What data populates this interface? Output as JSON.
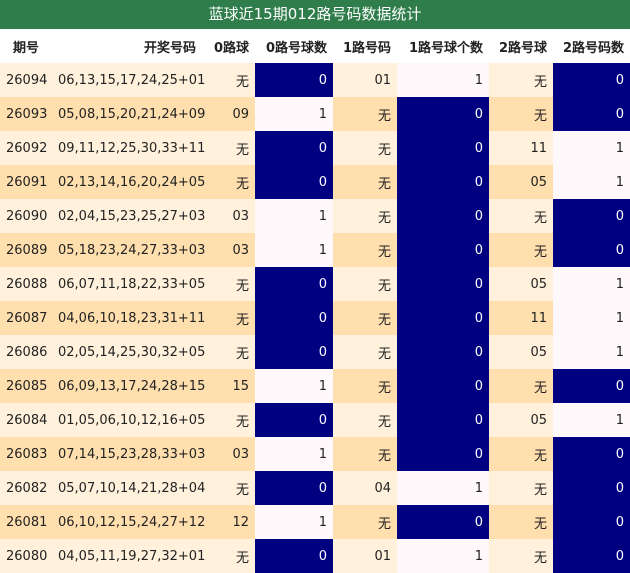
{
  "title": "蓝球近15期012路号码数据统计",
  "headers": [
    "期号",
    "开奖号码",
    "0路球",
    "0路号球数",
    "1路号码",
    "1路号球个数",
    "2路号球",
    "2路号码数"
  ],
  "rows": [
    {
      "period": "26094",
      "numbers": "06,13,15,17,24,25+01",
      "r0": "无",
      "r0c": "0",
      "r1": "01",
      "r1c": "1",
      "r2": "无",
      "r2c": "0"
    },
    {
      "period": "26093",
      "numbers": "05,08,15,20,21,24+09",
      "r0": "09",
      "r0c": "1",
      "r1": "无",
      "r1c": "0",
      "r2": "无",
      "r2c": "0"
    },
    {
      "period": "26092",
      "numbers": "09,11,12,25,30,33+11",
      "r0": "无",
      "r0c": "0",
      "r1": "无",
      "r1c": "0",
      "r2": "11",
      "r2c": "1"
    },
    {
      "period": "26091",
      "numbers": "02,13,14,16,20,24+05",
      "r0": "无",
      "r0c": "0",
      "r1": "无",
      "r1c": "0",
      "r2": "05",
      "r2c": "1"
    },
    {
      "period": "26090",
      "numbers": "02,04,15,23,25,27+03",
      "r0": "03",
      "r0c": "1",
      "r1": "无",
      "r1c": "0",
      "r2": "无",
      "r2c": "0"
    },
    {
      "period": "26089",
      "numbers": "05,18,23,24,27,33+03",
      "r0": "03",
      "r0c": "1",
      "r1": "无",
      "r1c": "0",
      "r2": "无",
      "r2c": "0"
    },
    {
      "period": "26088",
      "numbers": "06,07,11,18,22,33+05",
      "r0": "无",
      "r0c": "0",
      "r1": "无",
      "r1c": "0",
      "r2": "05",
      "r2c": "1"
    },
    {
      "period": "26087",
      "numbers": "04,06,10,18,23,31+11",
      "r0": "无",
      "r0c": "0",
      "r1": "无",
      "r1c": "0",
      "r2": "11",
      "r2c": "1"
    },
    {
      "period": "26086",
      "numbers": "02,05,14,25,30,32+05",
      "r0": "无",
      "r0c": "0",
      "r1": "无",
      "r1c": "0",
      "r2": "05",
      "r2c": "1"
    },
    {
      "period": "26085",
      "numbers": "06,09,13,17,24,28+15",
      "r0": "15",
      "r0c": "1",
      "r1": "无",
      "r1c": "0",
      "r2": "无",
      "r2c": "0"
    },
    {
      "period": "26084",
      "numbers": "01,05,06,10,12,16+05",
      "r0": "无",
      "r0c": "0",
      "r1": "无",
      "r1c": "0",
      "r2": "05",
      "r2c": "1"
    },
    {
      "period": "26083",
      "numbers": "07,14,15,23,28,33+03",
      "r0": "03",
      "r0c": "1",
      "r1": "无",
      "r1c": "0",
      "r2": "无",
      "r2c": "0"
    },
    {
      "period": "26082",
      "numbers": "05,07,10,14,21,28+04",
      "r0": "无",
      "r0c": "0",
      "r1": "04",
      "r1c": "1",
      "r2": "无",
      "r2c": "0"
    },
    {
      "period": "26081",
      "numbers": "06,10,12,15,24,27+12",
      "r0": "12",
      "r0c": "1",
      "r1": "无",
      "r1c": "0",
      "r2": "无",
      "r2c": "0"
    },
    {
      "period": "26080",
      "numbers": "04,05,11,19,27,32+01",
      "r0": "无",
      "r0c": "0",
      "r1": "01",
      "r1c": "1",
      "r2": "无",
      "r2c": "0"
    }
  ],
  "colors": {
    "title_bg": "#2e7d4a",
    "zero_cell": "#000080",
    "row_even": "#fff1dc",
    "row_odd": "#ffdfae",
    "count_one": "#fef8fa"
  }
}
